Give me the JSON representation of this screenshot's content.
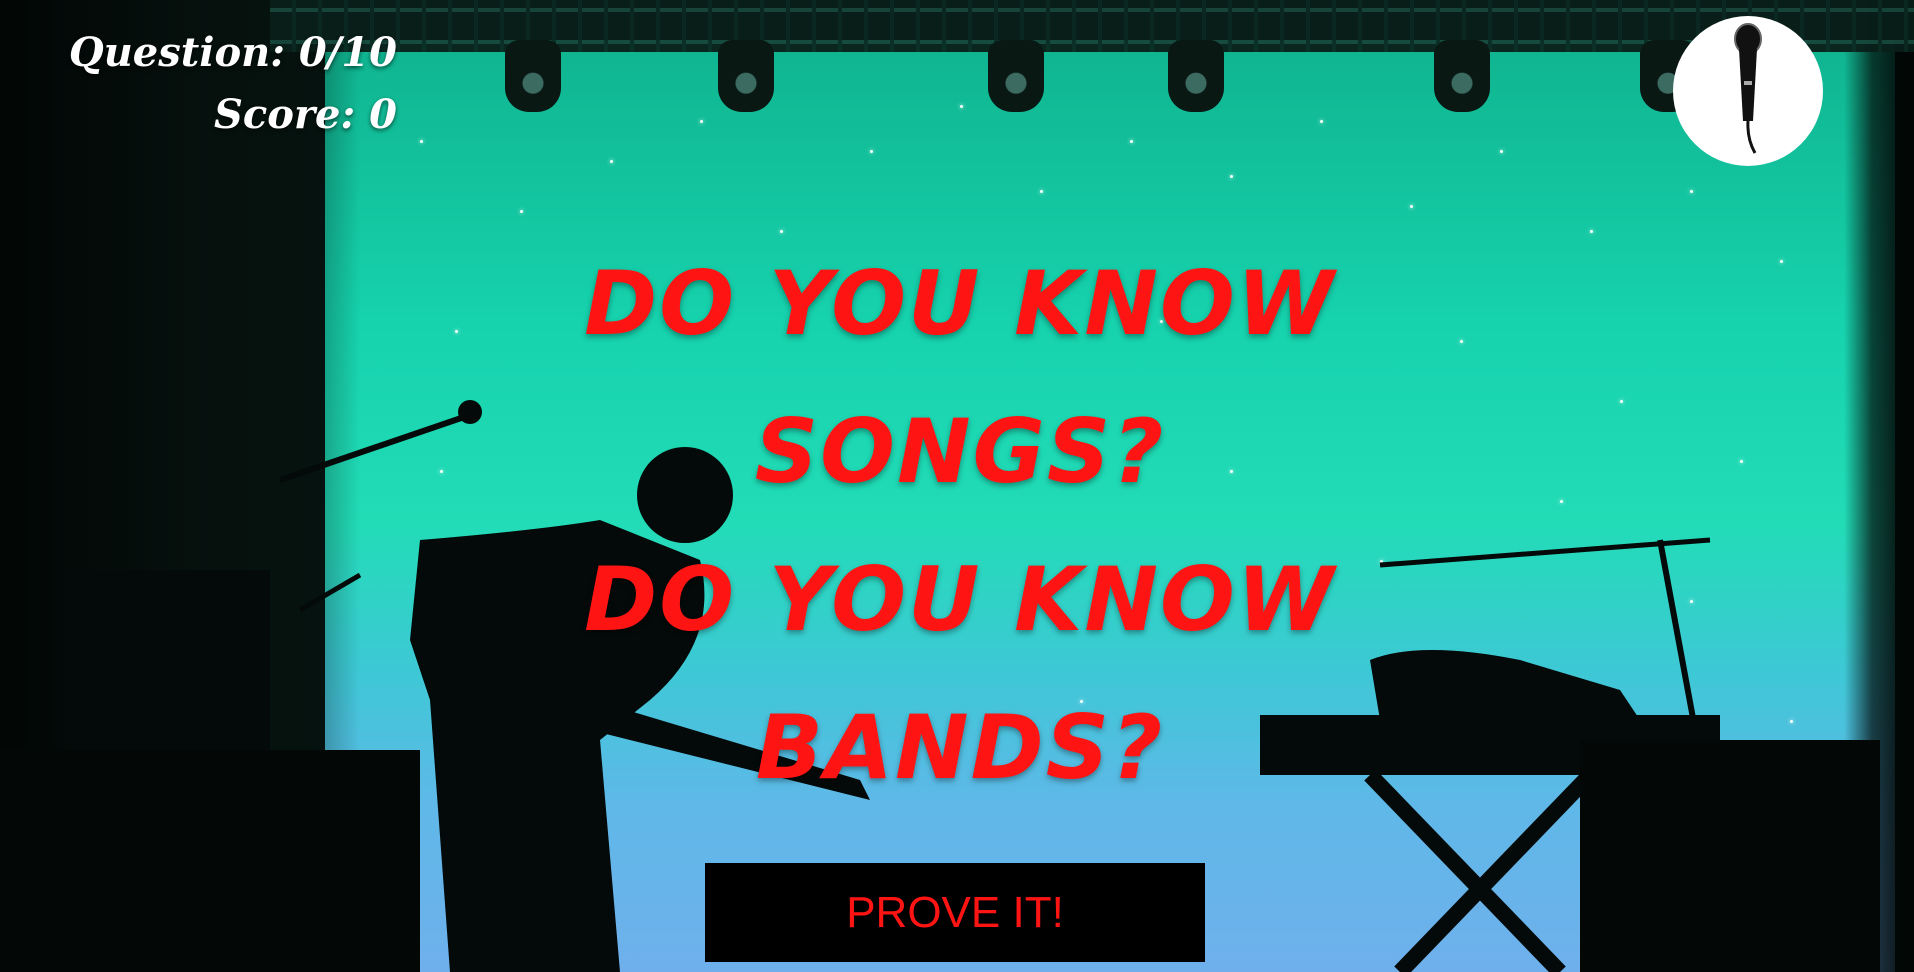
{
  "hud": {
    "question_label": "Question: 0/10",
    "score_label": "Score: 0"
  },
  "header": {
    "logo_icon": "microphone-icon"
  },
  "headline": {
    "lines": [
      "DO YOU KNOW",
      "SONGS?",
      "DO YOU KNOW",
      "BANDS?"
    ]
  },
  "cta": {
    "label": "PROVE IT!"
  },
  "colors": {
    "headline": "#ff1414",
    "cta_background": "#000000",
    "cta_text": "#ff1414",
    "hud_text": "#ffffff",
    "backdrop_top": "#0fb48f",
    "backdrop_bottom": "#6fb0ec"
  }
}
